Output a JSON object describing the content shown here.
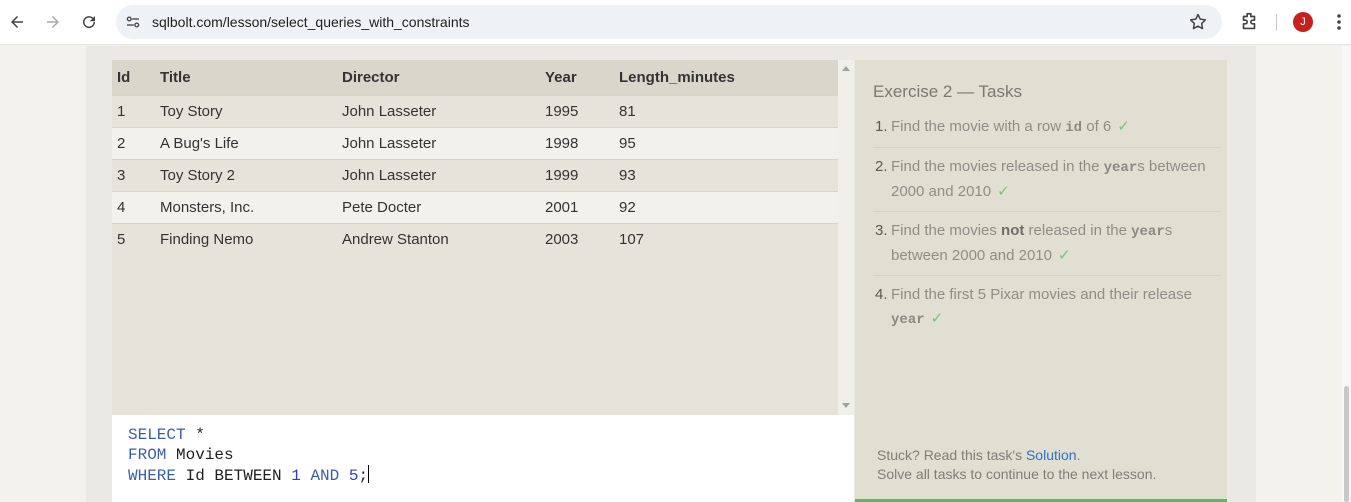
{
  "browser": {
    "url": "sqlbolt.com/lesson/select_queries_with_constraints",
    "avatar_letter": "J",
    "icons": [
      "back-icon",
      "forward-icon",
      "reload-icon",
      "site-settings-icon",
      "bookmark-star-icon",
      "extensions-icon",
      "menu-kebab-icon"
    ]
  },
  "table": {
    "headers": [
      "Id",
      "Title",
      "Director",
      "Year",
      "Length_minutes"
    ],
    "rows": [
      [
        "1",
        "Toy Story",
        "John Lasseter",
        "1995",
        "81"
      ],
      [
        "2",
        "A Bug's Life",
        "John Lasseter",
        "1998",
        "95"
      ],
      [
        "3",
        "Toy Story 2",
        "John Lasseter",
        "1999",
        "93"
      ],
      [
        "4",
        "Monsters, Inc.",
        "Pete Docter",
        "2001",
        "92"
      ],
      [
        "5",
        "Finding Nemo",
        "Andrew Stanton",
        "2003",
        "107"
      ]
    ]
  },
  "editor": {
    "line1_kw": "SELECT",
    "line1_rest": " *",
    "line2_kw": "FROM",
    "line2_rest": " Movies",
    "line3_kw1": "WHERE",
    "line3_a": " Id BETWEEN ",
    "line3_n1": "1",
    "line3_sp": " ",
    "line3_kw2": "AND",
    "line3_sp2": " ",
    "line3_n2": "5",
    "line3_end": ";"
  },
  "tasks": {
    "title": "Exercise 2 — Tasks",
    "items": [
      {
        "num": "1.",
        "pre": "Find the movie with a row ",
        "code": "id",
        "post": " of 6",
        "check": "✓"
      },
      {
        "num": "2.",
        "pre": "Find the movies released in the ",
        "code": "year",
        "post": "s between 2000 and 2010",
        "check": "✓"
      },
      {
        "num": "3.",
        "pre": "Find the movies ",
        "bold": "not",
        "mid": " released in the ",
        "code": "year",
        "post": "s between 2000 and 2010",
        "check": "✓"
      },
      {
        "num": "4.",
        "pre": "Find the first 5 Pixar movies and their release ",
        "code": "year",
        "post": "",
        "check": "✓"
      }
    ],
    "stuck_text": "Stuck? Read this task's ",
    "solution_link": "Solution",
    "stuck_end": ".",
    "continue_text": "Solve all tasks to continue to the next lesson."
  },
  "colors": {
    "accent": "#5cb85c",
    "link": "#2f6fcf",
    "keyword": "#3a5fa8"
  }
}
